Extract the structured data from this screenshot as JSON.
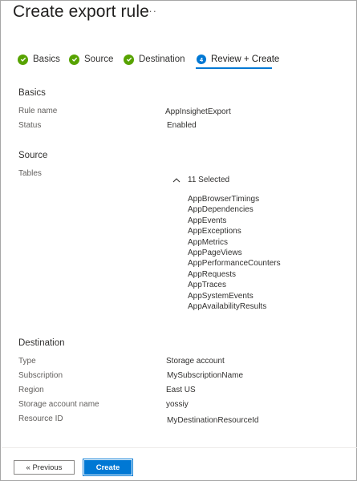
{
  "header": {
    "title": "Create export rule",
    "more_label": "···"
  },
  "steps": [
    {
      "label": "Basics",
      "state": "complete"
    },
    {
      "label": "Source",
      "state": "complete"
    },
    {
      "label": "Destination",
      "state": "complete"
    },
    {
      "label": "Review + Create",
      "state": "active",
      "number": "4"
    }
  ],
  "basics": {
    "heading": "Basics",
    "rule_name_label": "Rule name",
    "rule_name_value": "AppInsighetExport",
    "status_label": "Status",
    "status_value": "Enabled"
  },
  "source": {
    "heading": "Source",
    "tables_label": "Tables",
    "selected_summary": "11 Selected",
    "tables": [
      "AppBrowserTimings",
      "AppDependencies",
      "AppEvents",
      "AppExceptions",
      "AppMetrics",
      "AppPageViews",
      "AppPerformanceCounters",
      "AppRequests",
      "AppTraces",
      "AppSystemEvents",
      "AppAvailabilityResults"
    ]
  },
  "destination": {
    "heading": "Destination",
    "type_label": "Type",
    "type_value": "Storage account",
    "subscription_label": "Subscription",
    "subscription_value": "MySubscriptionName",
    "region_label": "Region",
    "region_value": "East US",
    "storage_label": "Storage account name",
    "storage_value": "yossiy",
    "resource_label": "Resource ID",
    "resource_value": "MyDestinationResourceId"
  },
  "footer": {
    "previous_label": "« Previous",
    "create_label": "Create"
  },
  "colors": {
    "accent": "#0078d4",
    "success": "#57a300"
  }
}
